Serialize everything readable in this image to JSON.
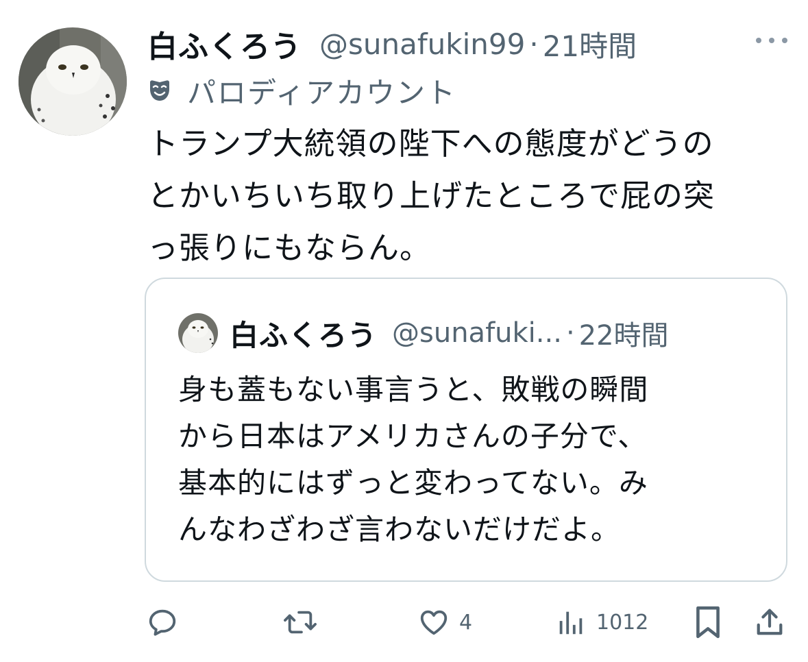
{
  "tweet": {
    "display_name": "白ふくろう",
    "handle": "@sunafukin99",
    "separator": "·",
    "timestamp": "21時間",
    "parody_label": "パロディアカウント",
    "body_lines": [
      "トランプ大統領の陛下への態度がどうの",
      "とかいちいち取り上げたところで屁の突",
      "っ張りにもならん。"
    ]
  },
  "quote": {
    "display_name": "白ふくろう",
    "handle": "@sunafuki...",
    "separator": "·",
    "timestamp": "22時間",
    "body_lines": [
      "身も蓋もない事言うと、敗戦の瞬間",
      "から日本はアメリカさんの子分で、",
      "基本的にはずっと変わってない。み",
      "んなわざわざ言わないだけだよ。"
    ]
  },
  "actions": {
    "reply": {
      "icon": "reply-icon",
      "count": ""
    },
    "retweet": {
      "icon": "retweet-icon",
      "count": ""
    },
    "like": {
      "icon": "heart-icon",
      "count": "4"
    },
    "views": {
      "icon": "views-icon",
      "count": "1012"
    },
    "bookmark": {
      "icon": "bookmark-icon",
      "count": ""
    },
    "share": {
      "icon": "share-icon",
      "count": ""
    }
  },
  "colors": {
    "text_primary": "#0f1419",
    "text_secondary": "#536471",
    "border": "#cfd9de",
    "icon": "#536471"
  }
}
